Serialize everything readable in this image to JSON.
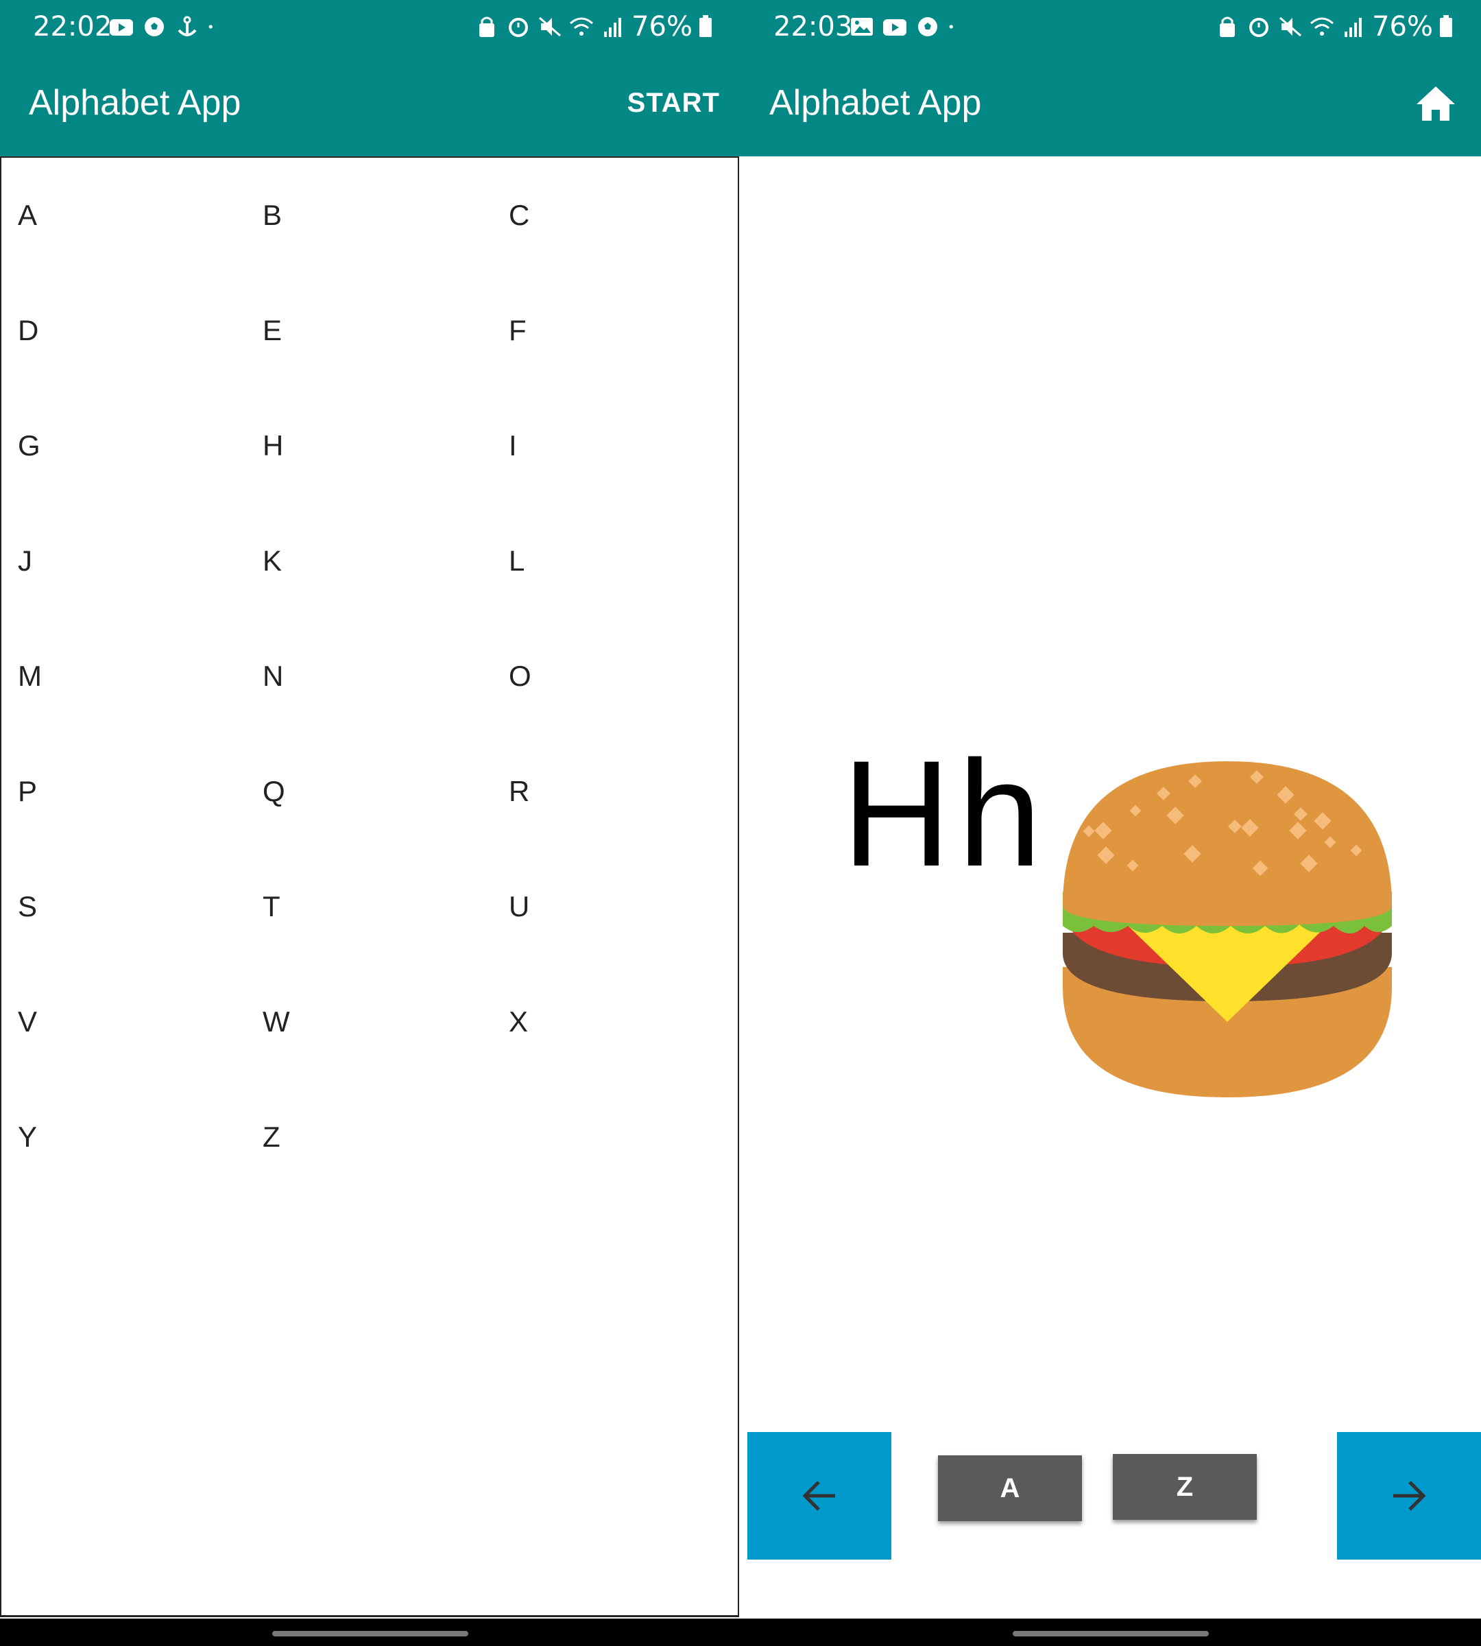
{
  "left": {
    "status": {
      "time": "22:02",
      "battery": "76%"
    },
    "appbar": {
      "title": "Alphabet App",
      "action": "START"
    },
    "letters": [
      "A",
      "B",
      "C",
      "D",
      "E",
      "F",
      "G",
      "H",
      "I",
      "J",
      "K",
      "L",
      "M",
      "N",
      "O",
      "P",
      "Q",
      "R",
      "S",
      "T",
      "U",
      "V",
      "W",
      "X",
      "Y",
      "Z"
    ]
  },
  "right": {
    "status": {
      "time": "22:03",
      "battery": "76%"
    },
    "appbar": {
      "title": "Alphabet App",
      "action_icon": "home-icon"
    },
    "card": {
      "letter": "Hh",
      "picture": "hamburger-emoji"
    },
    "controls": {
      "prev_icon": "arrow-left-icon",
      "first_label": "A",
      "last_label": "Z",
      "next_icon": "arrow-right-icon"
    }
  },
  "colors": {
    "primary": "#038886",
    "accent": "#0099CC",
    "button_gray": "#5a5a5a"
  }
}
